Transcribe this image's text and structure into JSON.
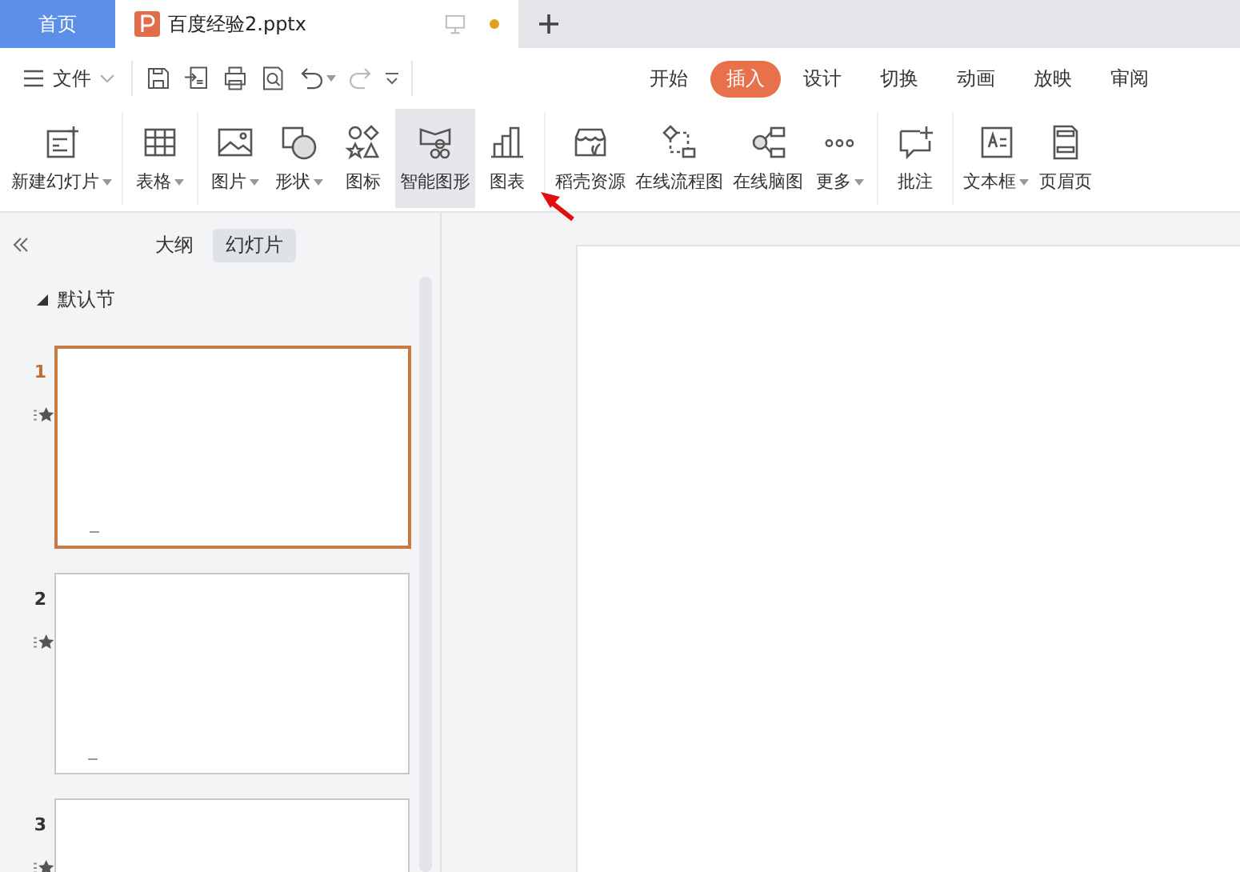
{
  "window_tabs": [
    {
      "kind": "home",
      "label": "首页"
    },
    {
      "kind": "document",
      "label": "百度经验2.pptx",
      "unsaved": true
    }
  ],
  "file_menu": {
    "label": "文件"
  },
  "ribbon_tabs": [
    {
      "label": "开始",
      "selected": false
    },
    {
      "label": "插入",
      "selected": true
    },
    {
      "label": "设计",
      "selected": false
    },
    {
      "label": "切换",
      "selected": false
    },
    {
      "label": "动画",
      "selected": false
    },
    {
      "label": "放映",
      "selected": false
    },
    {
      "label": "审阅",
      "selected": false
    }
  ],
  "ribbon_groups": [
    [
      {
        "label": "新建幻灯片",
        "dropdown": true,
        "highlighted": false
      }
    ],
    [
      {
        "label": "表格",
        "dropdown": true,
        "highlighted": false
      }
    ],
    [
      {
        "label": "图片",
        "dropdown": true,
        "highlighted": false
      },
      {
        "label": "形状",
        "dropdown": true,
        "highlighted": false
      },
      {
        "label": "图标",
        "dropdown": false,
        "highlighted": false
      },
      {
        "label": "智能图形",
        "dropdown": false,
        "highlighted": true
      },
      {
        "label": "图表",
        "dropdown": false,
        "highlighted": false
      }
    ],
    [
      {
        "label": "稻壳资源",
        "dropdown": false,
        "highlighted": false
      },
      {
        "label": "在线流程图",
        "dropdown": false,
        "highlighted": false
      },
      {
        "label": "在线脑图",
        "dropdown": false,
        "highlighted": false
      },
      {
        "label": "更多",
        "dropdown": true,
        "highlighted": false
      }
    ],
    [
      {
        "label": "批注",
        "dropdown": false,
        "highlighted": false
      }
    ],
    [
      {
        "label": "文本框",
        "dropdown": true,
        "highlighted": false
      },
      {
        "label": "页眉页",
        "dropdown": false,
        "highlighted": false
      }
    ]
  ],
  "panel_tabs": [
    {
      "label": "大纲",
      "selected": false
    },
    {
      "label": "幻灯片",
      "selected": true
    }
  ],
  "section": {
    "label": "默认节",
    "expanded": true
  },
  "slides": [
    {
      "number": "1",
      "selected": true
    },
    {
      "number": "2",
      "selected": false
    },
    {
      "number": "3",
      "selected": false
    }
  ]
}
